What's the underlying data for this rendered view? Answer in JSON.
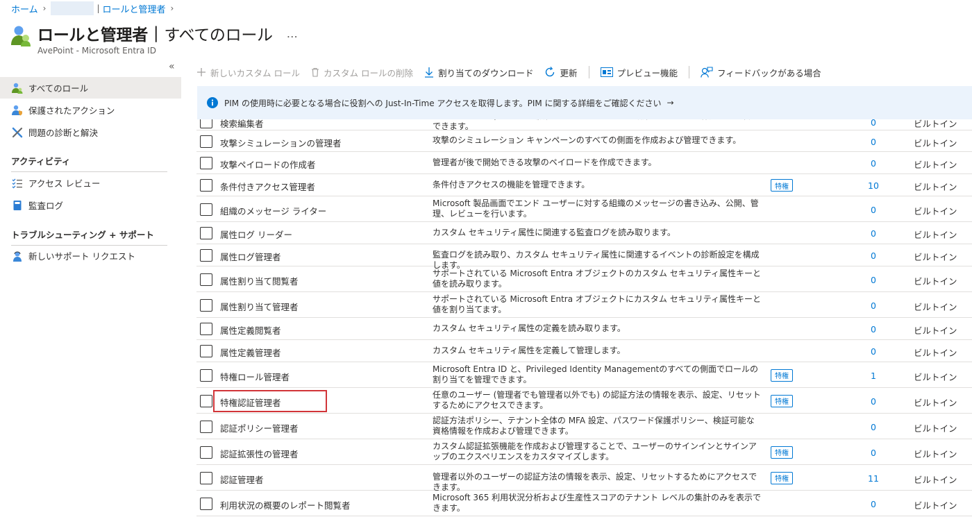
{
  "breadcrumb": {
    "home": "ホーム",
    "current": "ロールと管理者"
  },
  "header": {
    "title": "ロールと管理者",
    "separator": "|",
    "subtitle": "すべてのロール",
    "more": "…",
    "tenant": "AvePoint - Microsoft Entra ID"
  },
  "sidebar": {
    "collapse": "«",
    "items": [
      {
        "label": "すべてのロール",
        "icon": "roles-icon"
      },
      {
        "label": "保護されたアクション",
        "icon": "protected-actions-icon"
      },
      {
        "label": "問題の診断と解決",
        "icon": "wrench-icon"
      }
    ],
    "section_activity": "アクティビティ",
    "activity_items": [
      {
        "label": "アクセス レビュー",
        "icon": "checklist-icon"
      },
      {
        "label": "監査ログ",
        "icon": "book-icon"
      }
    ],
    "section_support": "トラブルシューティング + サポート",
    "support_items": [
      {
        "label": "新しいサポート リクエスト",
        "icon": "support-person-icon"
      }
    ]
  },
  "toolbar": {
    "new_custom_role": "新しいカスタム ロール",
    "delete_custom_role": "カスタム ロールの削除",
    "download": "割り当てのダウンロード",
    "refresh": "更新",
    "preview": "プレビュー機能",
    "feedback": "フィードバックがある場合"
  },
  "banner": {
    "text": "PIM の使用時に必要となる場合に役割への Just-In-Time アクセスを取得します。PIM に関する詳細をご確認ください",
    "arrow": "→"
  },
  "roles": [
    {
      "name": "検索編集者",
      "description": "ブックマーク、Q and A、場所、フロア プランなどの編集コンテンツを作成および管理できます。",
      "badge": "",
      "count": "0",
      "type": "ビルトイン"
    },
    {
      "name": "攻撃シミュレーションの管理者",
      "description": "攻撃のシミュレーション キャンペーンのすべての側面を作成および管理できます。",
      "badge": "",
      "count": "0",
      "type": "ビルトイン"
    },
    {
      "name": "攻撃ペイロードの作成者",
      "description": "管理者が後で開始できる攻撃のペイロードを作成できます。",
      "badge": "",
      "count": "0",
      "type": "ビルトイン"
    },
    {
      "name": "条件付きアクセス管理者",
      "description": "条件付きアクセスの機能を管理できます。",
      "badge": "特権",
      "count": "10",
      "type": "ビルトイン"
    },
    {
      "name": "組織のメッセージ ライター",
      "description": "Microsoft 製品画面でエンド ユーザーに対する組織のメッセージの書き込み、公開、管理、レビューを行います。",
      "badge": "",
      "count": "0",
      "type": "ビルトイン"
    },
    {
      "name": "属性ログ リーダー",
      "description": "カスタム セキュリティ属性に関連する監査ログを読み取ります。",
      "badge": "",
      "count": "0",
      "type": "ビルトイン"
    },
    {
      "name": "属性ログ管理者",
      "description": "監査ログを読み取り、カスタム セキュリティ属性に関連するイベントの診断設定を構成します。",
      "badge": "",
      "count": "0",
      "type": "ビルトイン"
    },
    {
      "name": "属性割り当て閲覧者",
      "description": "サポートされている Microsoft Entra オブジェクトのカスタム セキュリティ属性キーと値を読み取ります。",
      "badge": "",
      "count": "0",
      "type": "ビルトイン"
    },
    {
      "name": "属性割り当て管理者",
      "description": "サポートされている Microsoft Entra オブジェクトにカスタム セキュリティ属性キーと値を割り当てます。",
      "badge": "",
      "count": "0",
      "type": "ビルトイン"
    },
    {
      "name": "属性定義閲覧者",
      "description": "カスタム セキュリティ属性の定義を読み取ります。",
      "badge": "",
      "count": "0",
      "type": "ビルトイン"
    },
    {
      "name": "属性定義管理者",
      "description": "カスタム セキュリティ属性を定義して管理します。",
      "badge": "",
      "count": "0",
      "type": "ビルトイン"
    },
    {
      "name": "特権ロール管理者",
      "description": "Microsoft Entra ID と、Privileged Identity Managementのすべての側面でロールの割り当てを管理できます。",
      "badge": "特権",
      "count": "1",
      "type": "ビルトイン"
    },
    {
      "name": "特権認証管理者",
      "description": "任意のユーザー (管理者でも管理者以外でも) の認証方法の情報を表示、設定、リセットするためにアクセスできます。",
      "badge": "特権",
      "count": "0",
      "type": "ビルトイン",
      "highlighted": true
    },
    {
      "name": "認証ポリシー管理者",
      "description": "認証方法ポリシー、テナント全体の MFA 設定、パスワード保護ポリシー、検証可能な資格情報を作成および管理できます。",
      "badge": "",
      "count": "0",
      "type": "ビルトイン"
    },
    {
      "name": "認証拡張性の管理者",
      "description": "カスタム認証拡張機能を作成および管理することで、ユーザーのサインインとサインアップのエクスペリエンスをカスタマイズします。",
      "badge": "特権",
      "count": "0",
      "type": "ビルトイン"
    },
    {
      "name": "認証管理者",
      "description": "管理者以外のユーザーの認証方法の情報を表示、設定、リセットするためにアクセスできます。",
      "badge": "特権",
      "count": "11",
      "type": "ビルトイン"
    },
    {
      "name": "利用状況の概要のレポート閲覧者",
      "description": "Microsoft 365 利用状況分析および生産性スコアのテナント レベルの集計のみを表示できます。",
      "badge": "",
      "count": "0",
      "type": "ビルトイン"
    }
  ]
}
